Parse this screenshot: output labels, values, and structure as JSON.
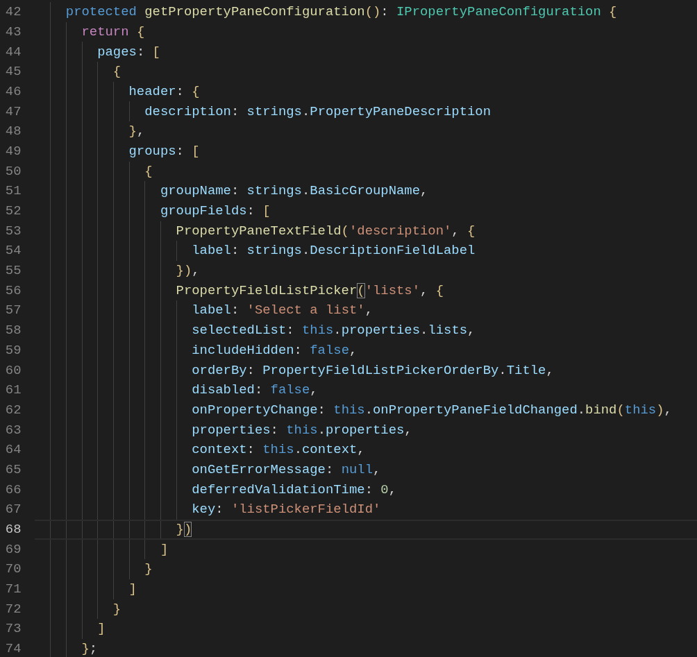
{
  "editor": {
    "lines": [
      {
        "number": "42",
        "current": false,
        "tokens": [
          {
            "kind": "keyword",
            "text": "protected "
          },
          {
            "kind": "function",
            "text": "getPropertyPaneConfiguration"
          },
          {
            "kind": "bracket",
            "text": "()"
          },
          {
            "kind": "plain",
            "text": ": "
          },
          {
            "kind": "type",
            "text": "IPropertyPaneConfiguration "
          },
          {
            "kind": "bracket",
            "text": "{"
          }
        ],
        "children": [
          {
            "number": "43",
            "current": false,
            "tokens": [
              {
                "kind": "control",
                "text": "return "
              },
              {
                "kind": "bracket",
                "text": "{"
              }
            ],
            "children": [
              {
                "number": "44",
                "current": false,
                "tokens": [
                  {
                    "kind": "property",
                    "text": "pages"
                  },
                  {
                    "kind": "plain",
                    "text": ": "
                  },
                  {
                    "kind": "bracket",
                    "text": "["
                  }
                ],
                "children": [
                  {
                    "number": "45",
                    "current": false,
                    "tokens": [
                      {
                        "kind": "bracket",
                        "text": "{"
                      }
                    ],
                    "children": [
                      {
                        "number": "46",
                        "current": false,
                        "tokens": [
                          {
                            "kind": "property",
                            "text": "header"
                          },
                          {
                            "kind": "plain",
                            "text": ": "
                          },
                          {
                            "kind": "bracket",
                            "text": "{"
                          }
                        ],
                        "children": [
                          {
                            "number": "47",
                            "current": false,
                            "tokens": [
                              {
                                "kind": "property",
                                "text": "description"
                              },
                              {
                                "kind": "plain",
                                "text": ": "
                              },
                              {
                                "kind": "property",
                                "text": "strings"
                              },
                              {
                                "kind": "plain",
                                "text": "."
                              },
                              {
                                "kind": "property",
                                "text": "PropertyPaneDescription"
                              }
                            ]
                          }
                        ]
                      },
                      {
                        "number": "48",
                        "current": false,
                        "tokens": [
                          {
                            "kind": "bracket",
                            "text": "}"
                          },
                          {
                            "kind": "plain",
                            "text": ","
                          }
                        ]
                      },
                      {
                        "number": "49",
                        "current": false,
                        "tokens": [
                          {
                            "kind": "property",
                            "text": "groups"
                          },
                          {
                            "kind": "plain",
                            "text": ": "
                          },
                          {
                            "kind": "bracket",
                            "text": "["
                          }
                        ],
                        "children": [
                          {
                            "number": "50",
                            "current": false,
                            "tokens": [
                              {
                                "kind": "bracket",
                                "text": "{"
                              }
                            ],
                            "children": [
                              {
                                "number": "51",
                                "current": false,
                                "tokens": [
                                  {
                                    "kind": "property",
                                    "text": "groupName"
                                  },
                                  {
                                    "kind": "plain",
                                    "text": ": "
                                  },
                                  {
                                    "kind": "property",
                                    "text": "strings"
                                  },
                                  {
                                    "kind": "plain",
                                    "text": "."
                                  },
                                  {
                                    "kind": "property",
                                    "text": "BasicGroupName"
                                  },
                                  {
                                    "kind": "plain",
                                    "text": ","
                                  }
                                ]
                              },
                              {
                                "number": "52",
                                "current": false,
                                "tokens": [
                                  {
                                    "kind": "property",
                                    "text": "groupFields"
                                  },
                                  {
                                    "kind": "plain",
                                    "text": ": "
                                  },
                                  {
                                    "kind": "bracket",
                                    "text": "["
                                  }
                                ],
                                "children": [
                                  {
                                    "number": "53",
                                    "current": false,
                                    "tokens": [
                                      {
                                        "kind": "function",
                                        "text": "PropertyPaneTextField"
                                      },
                                      {
                                        "kind": "bracket",
                                        "text": "("
                                      },
                                      {
                                        "kind": "string",
                                        "text": "'description'"
                                      },
                                      {
                                        "kind": "plain",
                                        "text": ", "
                                      },
                                      {
                                        "kind": "bracket",
                                        "text": "{"
                                      }
                                    ],
                                    "children": [
                                      {
                                        "number": "54",
                                        "current": false,
                                        "tokens": [
                                          {
                                            "kind": "property",
                                            "text": "label"
                                          },
                                          {
                                            "kind": "plain",
                                            "text": ": "
                                          },
                                          {
                                            "kind": "property",
                                            "text": "strings"
                                          },
                                          {
                                            "kind": "plain",
                                            "text": "."
                                          },
                                          {
                                            "kind": "property",
                                            "text": "DescriptionFieldLabel"
                                          }
                                        ]
                                      }
                                    ]
                                  },
                                  {
                                    "number": "55",
                                    "current": false,
                                    "tokens": [
                                      {
                                        "kind": "bracket",
                                        "text": "})"
                                      },
                                      {
                                        "kind": "plain",
                                        "text": ","
                                      }
                                    ]
                                  },
                                  {
                                    "number": "56",
                                    "current": false,
                                    "tokens": [
                                      {
                                        "kind": "function",
                                        "text": "PropertyFieldListPicker"
                                      },
                                      {
                                        "kind": "match",
                                        "text": "("
                                      },
                                      {
                                        "kind": "string",
                                        "text": "'lists'"
                                      },
                                      {
                                        "kind": "plain",
                                        "text": ", "
                                      },
                                      {
                                        "kind": "bracket",
                                        "text": "{"
                                      }
                                    ],
                                    "children": [
                                      {
                                        "number": "57",
                                        "current": false,
                                        "tokens": [
                                          {
                                            "kind": "property",
                                            "text": "label"
                                          },
                                          {
                                            "kind": "plain",
                                            "text": ": "
                                          },
                                          {
                                            "kind": "string",
                                            "text": "'Select a list'"
                                          },
                                          {
                                            "kind": "plain",
                                            "text": ","
                                          }
                                        ]
                                      },
                                      {
                                        "number": "58",
                                        "current": false,
                                        "tokens": [
                                          {
                                            "kind": "property",
                                            "text": "selectedList"
                                          },
                                          {
                                            "kind": "plain",
                                            "text": ": "
                                          },
                                          {
                                            "kind": "keyword",
                                            "text": "this"
                                          },
                                          {
                                            "kind": "plain",
                                            "text": "."
                                          },
                                          {
                                            "kind": "property",
                                            "text": "properties"
                                          },
                                          {
                                            "kind": "plain",
                                            "text": "."
                                          },
                                          {
                                            "kind": "property",
                                            "text": "lists"
                                          },
                                          {
                                            "kind": "plain",
                                            "text": ","
                                          }
                                        ]
                                      },
                                      {
                                        "number": "59",
                                        "current": false,
                                        "tokens": [
                                          {
                                            "kind": "property",
                                            "text": "includeHidden"
                                          },
                                          {
                                            "kind": "plain",
                                            "text": ": "
                                          },
                                          {
                                            "kind": "keyword",
                                            "text": "false"
                                          },
                                          {
                                            "kind": "plain",
                                            "text": ","
                                          }
                                        ]
                                      },
                                      {
                                        "number": "60",
                                        "current": false,
                                        "tokens": [
                                          {
                                            "kind": "property",
                                            "text": "orderBy"
                                          },
                                          {
                                            "kind": "plain",
                                            "text": ": "
                                          },
                                          {
                                            "kind": "property",
                                            "text": "PropertyFieldListPickerOrderBy"
                                          },
                                          {
                                            "kind": "plain",
                                            "text": "."
                                          },
                                          {
                                            "kind": "property",
                                            "text": "Title"
                                          },
                                          {
                                            "kind": "plain",
                                            "text": ","
                                          }
                                        ]
                                      },
                                      {
                                        "number": "61",
                                        "current": false,
                                        "tokens": [
                                          {
                                            "kind": "property",
                                            "text": "disabled"
                                          },
                                          {
                                            "kind": "plain",
                                            "text": ": "
                                          },
                                          {
                                            "kind": "keyword",
                                            "text": "false"
                                          },
                                          {
                                            "kind": "plain",
                                            "text": ","
                                          }
                                        ]
                                      },
                                      {
                                        "number": "62",
                                        "current": false,
                                        "tokens": [
                                          {
                                            "kind": "property",
                                            "text": "onPropertyChange"
                                          },
                                          {
                                            "kind": "plain",
                                            "text": ": "
                                          },
                                          {
                                            "kind": "keyword",
                                            "text": "this"
                                          },
                                          {
                                            "kind": "plain",
                                            "text": "."
                                          },
                                          {
                                            "kind": "property",
                                            "text": "onPropertyPaneFieldChanged"
                                          },
                                          {
                                            "kind": "plain",
                                            "text": "."
                                          },
                                          {
                                            "kind": "function",
                                            "text": "bind"
                                          },
                                          {
                                            "kind": "bracket",
                                            "text": "("
                                          },
                                          {
                                            "kind": "keyword",
                                            "text": "this"
                                          },
                                          {
                                            "kind": "bracket",
                                            "text": ")"
                                          },
                                          {
                                            "kind": "plain",
                                            "text": ","
                                          }
                                        ]
                                      },
                                      {
                                        "number": "63",
                                        "current": false,
                                        "tokens": [
                                          {
                                            "kind": "property",
                                            "text": "properties"
                                          },
                                          {
                                            "kind": "plain",
                                            "text": ": "
                                          },
                                          {
                                            "kind": "keyword",
                                            "text": "this"
                                          },
                                          {
                                            "kind": "plain",
                                            "text": "."
                                          },
                                          {
                                            "kind": "property",
                                            "text": "properties"
                                          },
                                          {
                                            "kind": "plain",
                                            "text": ","
                                          }
                                        ]
                                      },
                                      {
                                        "number": "64",
                                        "current": false,
                                        "tokens": [
                                          {
                                            "kind": "property",
                                            "text": "context"
                                          },
                                          {
                                            "kind": "plain",
                                            "text": ": "
                                          },
                                          {
                                            "kind": "keyword",
                                            "text": "this"
                                          },
                                          {
                                            "kind": "plain",
                                            "text": "."
                                          },
                                          {
                                            "kind": "property",
                                            "text": "context"
                                          },
                                          {
                                            "kind": "plain",
                                            "text": ","
                                          }
                                        ]
                                      },
                                      {
                                        "number": "65",
                                        "current": false,
                                        "tokens": [
                                          {
                                            "kind": "property",
                                            "text": "onGetErrorMessage"
                                          },
                                          {
                                            "kind": "plain",
                                            "text": ": "
                                          },
                                          {
                                            "kind": "keyword",
                                            "text": "null"
                                          },
                                          {
                                            "kind": "plain",
                                            "text": ","
                                          }
                                        ]
                                      },
                                      {
                                        "number": "66",
                                        "current": false,
                                        "tokens": [
                                          {
                                            "kind": "property",
                                            "text": "deferredValidationTime"
                                          },
                                          {
                                            "kind": "plain",
                                            "text": ": "
                                          },
                                          {
                                            "kind": "number",
                                            "text": "0"
                                          },
                                          {
                                            "kind": "plain",
                                            "text": ","
                                          }
                                        ]
                                      },
                                      {
                                        "number": "67",
                                        "current": false,
                                        "tokens": [
                                          {
                                            "kind": "property",
                                            "text": "key"
                                          },
                                          {
                                            "kind": "plain",
                                            "text": ": "
                                          },
                                          {
                                            "kind": "string",
                                            "text": "'listPickerFieldId'"
                                          }
                                        ]
                                      }
                                    ]
                                  },
                                  {
                                    "number": "68",
                                    "current": true,
                                    "tokens": [
                                      {
                                        "kind": "bracket",
                                        "text": "}"
                                      },
                                      {
                                        "kind": "match",
                                        "text": ")"
                                      }
                                    ]
                                  }
                                ]
                              },
                              {
                                "number": "69",
                                "current": false,
                                "tokens": [
                                  {
                                    "kind": "bracket",
                                    "text": "]"
                                  }
                                ]
                              }
                            ]
                          },
                          {
                            "number": "70",
                            "current": false,
                            "tokens": [
                              {
                                "kind": "bracket",
                                "text": "}"
                              }
                            ]
                          }
                        ]
                      },
                      {
                        "number": "71",
                        "current": false,
                        "tokens": [
                          {
                            "kind": "bracket",
                            "text": "]"
                          }
                        ]
                      }
                    ]
                  },
                  {
                    "number": "72",
                    "current": false,
                    "tokens": [
                      {
                        "kind": "bracket",
                        "text": "}"
                      }
                    ]
                  }
                ]
              },
              {
                "number": "73",
                "current": false,
                "tokens": [
                  {
                    "kind": "bracket",
                    "text": "]"
                  }
                ]
              }
            ]
          },
          {
            "number": "74",
            "current": false,
            "tokens": [
              {
                "kind": "bracket",
                "text": "}"
              },
              {
                "kind": "plain",
                "text": ";"
              }
            ]
          }
        ]
      }
    ]
  }
}
